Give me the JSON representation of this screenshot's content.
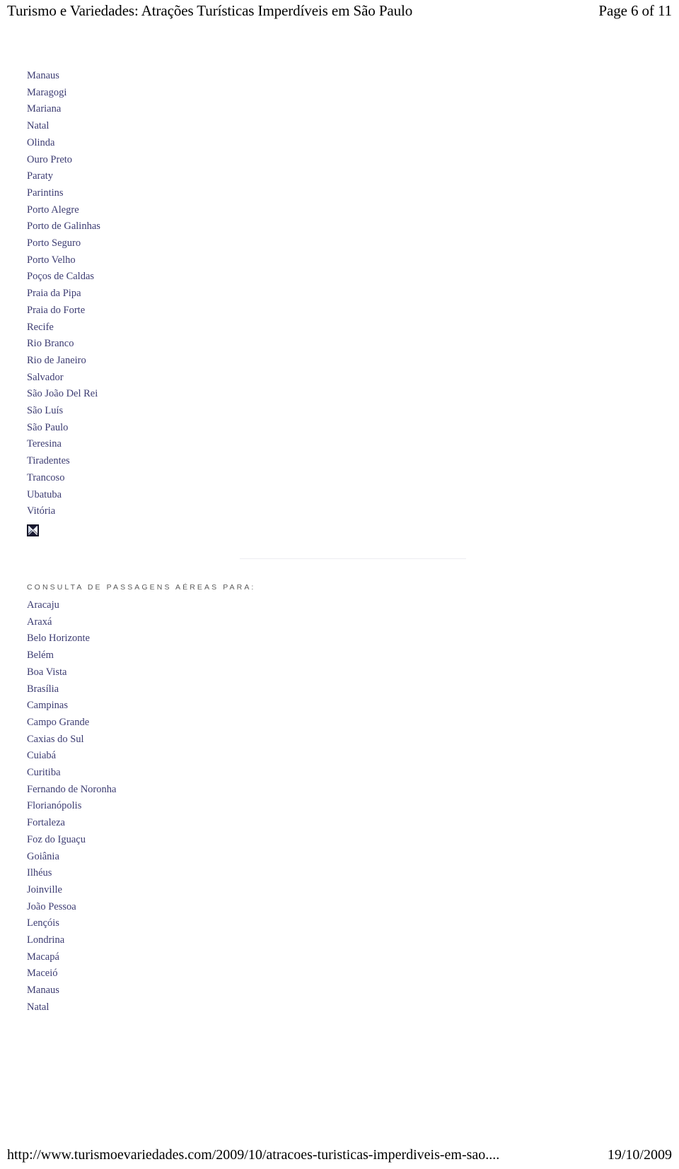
{
  "print_header": {
    "title": "Turismo e Variedades: Atrações Turísticas Imperdíveis em São Paulo",
    "page_indicator": "Page 6 of 11"
  },
  "destinations_list": {
    "items": [
      "Manaus",
      "Maragogi",
      "Mariana",
      "Natal",
      "Olinda",
      "Ouro Preto",
      "Paraty",
      "Parintins",
      "Porto Alegre",
      "Porto de Galinhas",
      "Porto Seguro",
      "Porto Velho",
      "Poços de Caldas",
      "Praia da Pipa",
      "Praia do Forte",
      "Recife",
      "Rio Branco",
      "Rio de Janeiro",
      "Salvador",
      "São João Del Rei",
      "São Luís",
      "São Paulo",
      "Teresina",
      "Tiradentes",
      "Trancoso",
      "Ubatuba",
      "Vitória"
    ]
  },
  "broken_image": {
    "icon": "broken-image-icon",
    "alt": ""
  },
  "airfare_section": {
    "heading": "C O N S U L T A   D E   P A S S A G E N S   A É R E A S   P A R A :",
    "heading_plain": "CONSULTA DE PASSAGENS AÉREAS PARA:",
    "items": [
      "Aracaju",
      "Araxá",
      "Belo Horizonte",
      "Belém",
      "Boa Vista",
      "Brasília",
      "Campinas",
      "Campo Grande",
      "Caxias do Sul",
      "Cuiabá",
      "Curitiba",
      "Fernando de Noronha",
      "Florianópolis",
      "Fortaleza",
      "Foz do Iguaçu",
      "Goiânia",
      "Ilhéus",
      "Joinville",
      "João Pessoa",
      "Lençóis",
      "Londrina",
      "Macapá",
      "Maceió",
      "Manaus",
      "Natal"
    ]
  },
  "print_footer": {
    "url": "http://www.turismoevariedades.com/2009/10/atracoes-turisticas-imperdiveis-em-sao....",
    "date": "19/10/2009"
  },
  "colors": {
    "link": "#3c3c72",
    "heading": "#595959",
    "divider": "#ededf1",
    "text": "#000000",
    "background": "#ffffff",
    "broken_icon_bg": "#1b1b33"
  }
}
